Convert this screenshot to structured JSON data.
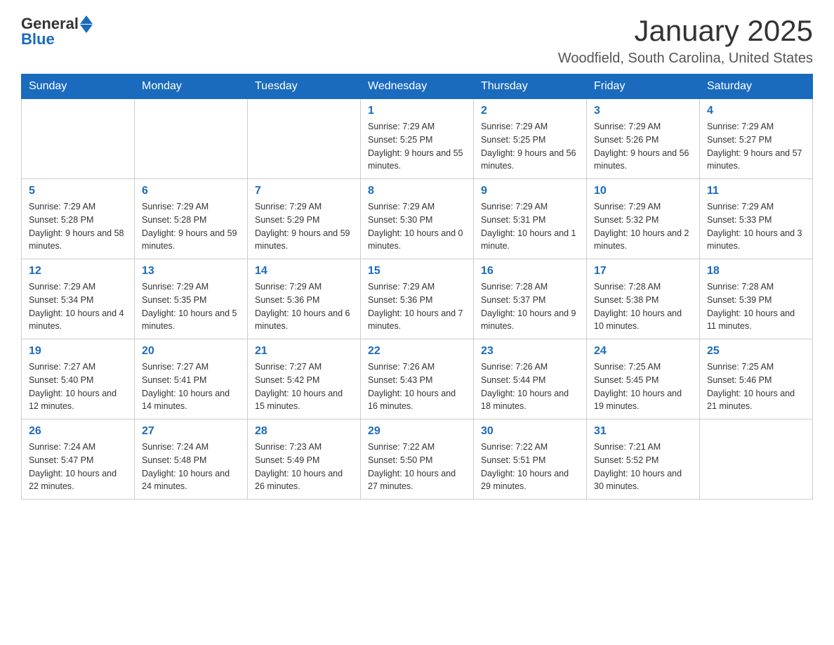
{
  "header": {
    "logo_general": "General",
    "logo_blue": "Blue",
    "month_title": "January 2025",
    "location": "Woodfield, South Carolina, United States"
  },
  "days_of_week": [
    "Sunday",
    "Monday",
    "Tuesday",
    "Wednesday",
    "Thursday",
    "Friday",
    "Saturday"
  ],
  "weeks": [
    [
      {
        "day": "",
        "info": ""
      },
      {
        "day": "",
        "info": ""
      },
      {
        "day": "",
        "info": ""
      },
      {
        "day": "1",
        "info": "Sunrise: 7:29 AM\nSunset: 5:25 PM\nDaylight: 9 hours and 55 minutes."
      },
      {
        "day": "2",
        "info": "Sunrise: 7:29 AM\nSunset: 5:25 PM\nDaylight: 9 hours and 56 minutes."
      },
      {
        "day": "3",
        "info": "Sunrise: 7:29 AM\nSunset: 5:26 PM\nDaylight: 9 hours and 56 minutes."
      },
      {
        "day": "4",
        "info": "Sunrise: 7:29 AM\nSunset: 5:27 PM\nDaylight: 9 hours and 57 minutes."
      }
    ],
    [
      {
        "day": "5",
        "info": "Sunrise: 7:29 AM\nSunset: 5:28 PM\nDaylight: 9 hours and 58 minutes."
      },
      {
        "day": "6",
        "info": "Sunrise: 7:29 AM\nSunset: 5:28 PM\nDaylight: 9 hours and 59 minutes."
      },
      {
        "day": "7",
        "info": "Sunrise: 7:29 AM\nSunset: 5:29 PM\nDaylight: 9 hours and 59 minutes."
      },
      {
        "day": "8",
        "info": "Sunrise: 7:29 AM\nSunset: 5:30 PM\nDaylight: 10 hours and 0 minutes."
      },
      {
        "day": "9",
        "info": "Sunrise: 7:29 AM\nSunset: 5:31 PM\nDaylight: 10 hours and 1 minute."
      },
      {
        "day": "10",
        "info": "Sunrise: 7:29 AM\nSunset: 5:32 PM\nDaylight: 10 hours and 2 minutes."
      },
      {
        "day": "11",
        "info": "Sunrise: 7:29 AM\nSunset: 5:33 PM\nDaylight: 10 hours and 3 minutes."
      }
    ],
    [
      {
        "day": "12",
        "info": "Sunrise: 7:29 AM\nSunset: 5:34 PM\nDaylight: 10 hours and 4 minutes."
      },
      {
        "day": "13",
        "info": "Sunrise: 7:29 AM\nSunset: 5:35 PM\nDaylight: 10 hours and 5 minutes."
      },
      {
        "day": "14",
        "info": "Sunrise: 7:29 AM\nSunset: 5:36 PM\nDaylight: 10 hours and 6 minutes."
      },
      {
        "day": "15",
        "info": "Sunrise: 7:29 AM\nSunset: 5:36 PM\nDaylight: 10 hours and 7 minutes."
      },
      {
        "day": "16",
        "info": "Sunrise: 7:28 AM\nSunset: 5:37 PM\nDaylight: 10 hours and 9 minutes."
      },
      {
        "day": "17",
        "info": "Sunrise: 7:28 AM\nSunset: 5:38 PM\nDaylight: 10 hours and 10 minutes."
      },
      {
        "day": "18",
        "info": "Sunrise: 7:28 AM\nSunset: 5:39 PM\nDaylight: 10 hours and 11 minutes."
      }
    ],
    [
      {
        "day": "19",
        "info": "Sunrise: 7:27 AM\nSunset: 5:40 PM\nDaylight: 10 hours and 12 minutes."
      },
      {
        "day": "20",
        "info": "Sunrise: 7:27 AM\nSunset: 5:41 PM\nDaylight: 10 hours and 14 minutes."
      },
      {
        "day": "21",
        "info": "Sunrise: 7:27 AM\nSunset: 5:42 PM\nDaylight: 10 hours and 15 minutes."
      },
      {
        "day": "22",
        "info": "Sunrise: 7:26 AM\nSunset: 5:43 PM\nDaylight: 10 hours and 16 minutes."
      },
      {
        "day": "23",
        "info": "Sunrise: 7:26 AM\nSunset: 5:44 PM\nDaylight: 10 hours and 18 minutes."
      },
      {
        "day": "24",
        "info": "Sunrise: 7:25 AM\nSunset: 5:45 PM\nDaylight: 10 hours and 19 minutes."
      },
      {
        "day": "25",
        "info": "Sunrise: 7:25 AM\nSunset: 5:46 PM\nDaylight: 10 hours and 21 minutes."
      }
    ],
    [
      {
        "day": "26",
        "info": "Sunrise: 7:24 AM\nSunset: 5:47 PM\nDaylight: 10 hours and 22 minutes."
      },
      {
        "day": "27",
        "info": "Sunrise: 7:24 AM\nSunset: 5:48 PM\nDaylight: 10 hours and 24 minutes."
      },
      {
        "day": "28",
        "info": "Sunrise: 7:23 AM\nSunset: 5:49 PM\nDaylight: 10 hours and 26 minutes."
      },
      {
        "day": "29",
        "info": "Sunrise: 7:22 AM\nSunset: 5:50 PM\nDaylight: 10 hours and 27 minutes."
      },
      {
        "day": "30",
        "info": "Sunrise: 7:22 AM\nSunset: 5:51 PM\nDaylight: 10 hours and 29 minutes."
      },
      {
        "day": "31",
        "info": "Sunrise: 7:21 AM\nSunset: 5:52 PM\nDaylight: 10 hours and 30 minutes."
      },
      {
        "day": "",
        "info": ""
      }
    ]
  ]
}
